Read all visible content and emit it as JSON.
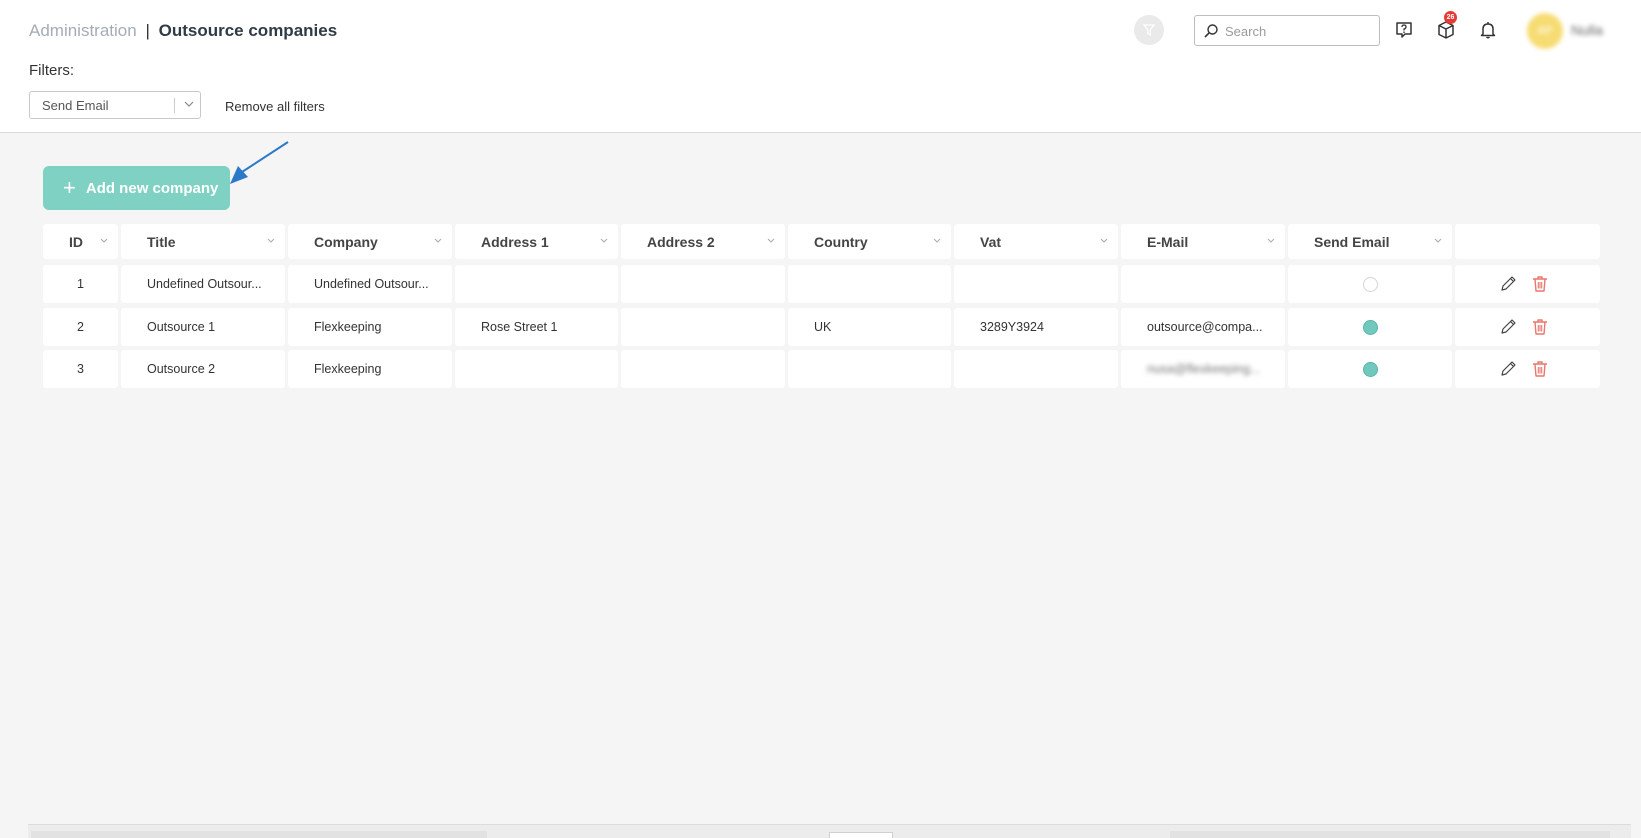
{
  "header": {
    "breadcrumb_parent": "Administration",
    "breadcrumb_separator": "|",
    "breadcrumb_current": "Outsource companies",
    "search_placeholder": "Search",
    "notification_badge": "26",
    "avatar_initials": "AP",
    "username": "Nulla"
  },
  "filters": {
    "label": "Filters:",
    "selected": "Send Email",
    "remove_all_label": "Remove all filters"
  },
  "toolbar": {
    "add_button_label": "Add new company"
  },
  "table": {
    "columns": [
      "ID",
      "Title",
      "Company",
      "Address 1",
      "Address 2",
      "Country",
      "Vat",
      "E-Mail",
      "Send Email",
      ""
    ],
    "rows": [
      {
        "id": "1",
        "title": "Undefined Outsour...",
        "company": "Undefined Outsour...",
        "address1": "",
        "address2": "",
        "country": "",
        "vat": "",
        "email": "",
        "send_email": false
      },
      {
        "id": "2",
        "title": "Outsource 1",
        "company": "Flexkeeping",
        "address1": "Rose Street 1",
        "address2": "",
        "country": "UK",
        "vat": "3289Y3924",
        "email": "outsource@compa...",
        "send_email": true
      },
      {
        "id": "3",
        "title": "Outsource 2",
        "company": "Flexkeeping",
        "address1": "",
        "address2": "",
        "country": "",
        "vat": "",
        "email": "nusa@flexkeeping...",
        "send_email": true
      }
    ]
  },
  "colors": {
    "accent": "#7fd1c4",
    "radio_on": "#71c9bd",
    "delete": "#e8766d",
    "badge": "#e53935"
  },
  "icons": {
    "funnel": "funnel-icon",
    "search": "search-icon",
    "help": "help-icon",
    "box": "box-icon",
    "bell": "bell-icon",
    "edit": "pencil-icon",
    "delete": "trash-icon"
  }
}
